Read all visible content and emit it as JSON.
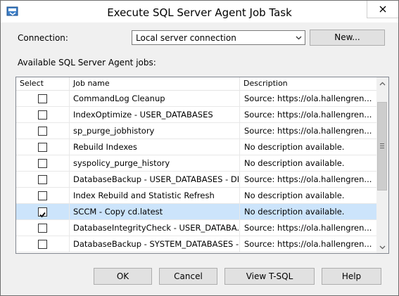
{
  "window": {
    "title": "Execute SQL Server Agent Job Task"
  },
  "connection": {
    "label": "Connection:",
    "value": "Local server connection",
    "new_button": "New..."
  },
  "jobs": {
    "section_label": "Available SQL Server Agent jobs:",
    "columns": {
      "select": "Select",
      "name": "Job name",
      "description": "Description"
    },
    "rows": [
      {
        "name": "CommandLog Cleanup",
        "description": "Source: https://ola.hallengren...",
        "checked": false
      },
      {
        "name": "IndexOptimize - USER_DATABASES",
        "description": "Source: https://ola.hallengren...",
        "checked": false
      },
      {
        "name": "sp_purge_jobhistory",
        "description": "Source: https://ola.hallengren...",
        "checked": false
      },
      {
        "name": "Rebuild Indexes",
        "description": "No description available.",
        "checked": false
      },
      {
        "name": "syspolicy_purge_history",
        "description": "No description available.",
        "checked": false
      },
      {
        "name": "DatabaseBackup - USER_DATABASES - DIFF",
        "description": "Source: https://ola.hallengren...",
        "checked": false
      },
      {
        "name": "Index Rebuild and Statistic Refresh",
        "description": "No description available.",
        "checked": false
      },
      {
        "name": "SCCM - Copy cd.latest",
        "description": "No description available.",
        "checked": true
      },
      {
        "name": "DatabaseIntegrityCheck - USER_DATABA...",
        "description": "Source: https://ola.hallengren...",
        "checked": false
      },
      {
        "name": "DatabaseBackup - SYSTEM_DATABASES -...",
        "description": "Source: https://ola.hallengren...",
        "checked": false
      }
    ]
  },
  "buttons": {
    "ok": "OK",
    "cancel": "Cancel",
    "view_tsql": "View T-SQL",
    "help": "Help"
  },
  "colors": {
    "selected_row": "#cce4fb",
    "window_bg": "#f0f0f0"
  },
  "icons": {
    "app": "ssis-task-icon",
    "close": "close-icon",
    "dropdown": "chevron-down-icon",
    "scroll_up": "chevron-up-icon",
    "scroll_down": "chevron-down-icon"
  }
}
